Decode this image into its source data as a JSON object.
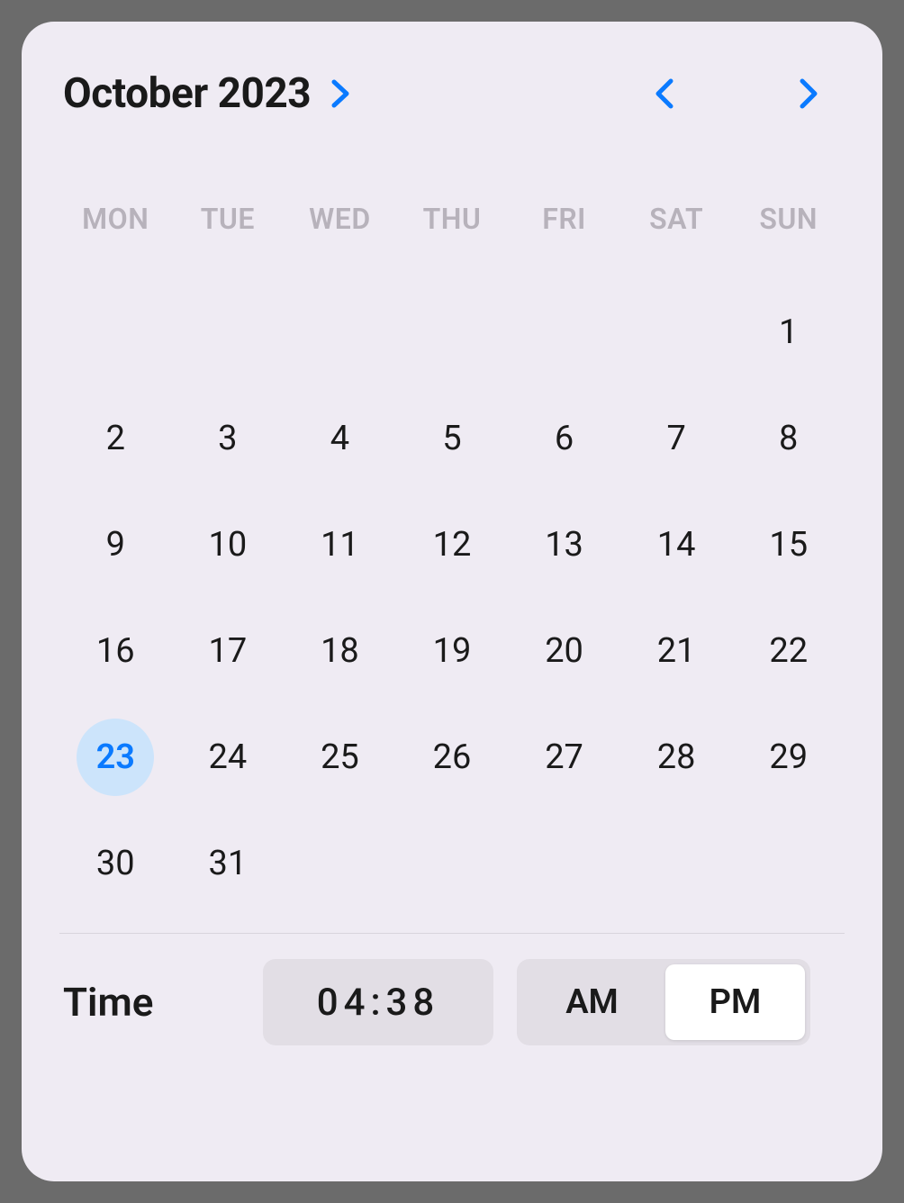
{
  "header": {
    "month_year": "October 2023"
  },
  "dow": [
    "MON",
    "TUE",
    "WED",
    "THU",
    "FRI",
    "SAT",
    "SUN"
  ],
  "calendar": {
    "leading_blanks": 6,
    "days": [
      1,
      2,
      3,
      4,
      5,
      6,
      7,
      8,
      9,
      10,
      11,
      12,
      13,
      14,
      15,
      16,
      17,
      18,
      19,
      20,
      21,
      22,
      23,
      24,
      25,
      26,
      27,
      28,
      29,
      30,
      31
    ],
    "selected_day": 23
  },
  "time": {
    "label": "Time",
    "value": "04:38",
    "am": "AM",
    "pm": "PM",
    "selected": "PM"
  },
  "colors": {
    "accent": "#0a7aff",
    "selected_bg": "#cce4fb",
    "panel_bg": "#efebf3"
  }
}
